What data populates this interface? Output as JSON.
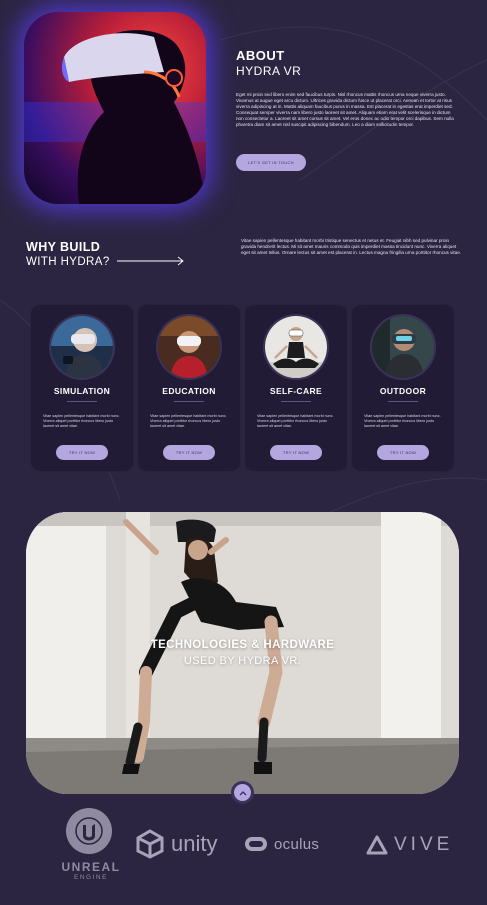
{
  "about": {
    "title": "ABOUT",
    "subtitle": "HYDRA VR",
    "text": "Eget mi proin sed libero enim sed faucibus turpis. Nisl rhoncus mattis rhoncus urna neque viverra justo. Vivamus at augue eget arcu dictum. Ultrices gravida dictum fusce ut placerat orci. Aenean et tortor at risus viverra adipiscing at in. Mattis aliquam faucibus purus in massa. Est placerat in egestas erat imperdiet sed. Consequat semper viverra nam libero justo laoreet sit amet. Aliquam etiam erat velit scelerisque in dictum non consectetur a. Laoreet sit amet cursus sit amet. Vel eros donec ac odio tempor orci dapibus. Sem nulla pharetra diam sit amet nisl suscipit adipiscing bibendum. Leo a diam sollicitudin tempor.",
    "button": "LET'S GET IN TOUCH"
  },
  "why": {
    "title": "WHY BUILD",
    "subtitle": "WITH HYDRA?",
    "text": "Vitae sapien pellentesque habitant morbi tristique senectus et netus et. Feugiat nibh sed pulvinar proin gravida hendrerit lectus. Mi sit amet mauris commodo quis imperdiet massa tincidunt nunc. Viverra aliquet eget sit amet tellus. Ornare lectus sit amet est placerat in. Lectus magna fringilla urna porttitor rhoncus vitae."
  },
  "cards": [
    {
      "title": "SIMULATION",
      "text": "Vitae sapien pellentesque habitant morbi nunc. Viverra aliquet porttitor rhoncus libero justo laoreet sit amet vitae.",
      "button": "TRY IT NOW"
    },
    {
      "title": "EDUCATION",
      "text": "Vitae sapien pellentesque habitant morbi nunc. Viverra aliquet porttitor rhoncus libero justo laoreet sit amet vitae.",
      "button": "TRY IT NOW"
    },
    {
      "title": "SELF-CARE",
      "text": "Vitae sapien pellentesque habitant morbi nunc. Viverra aliquet porttitor rhoncus libero justo laoreet sit amet vitae.",
      "button": "TRY IT NOW"
    },
    {
      "title": "OUTDOOR",
      "text": "Vitae sapien pellentesque habitant morbi nunc. Viverra aliquet porttitor rhoncus libero justo laoreet sit amet vitae.",
      "button": "TRY IT NOW"
    }
  ],
  "hero": {
    "title": "TECHNOLOGIES & HARDWARE",
    "subtitle": "USED BY HYDRA VR."
  },
  "logos": {
    "unreal_line1": "UNREAL",
    "unreal_line2": "ENGINE",
    "unity": "unity",
    "oculus": "oculus",
    "vive": "VIVE"
  },
  "icons": {
    "arrow": "arrow-right-icon",
    "scroll": "chevron-up-icon"
  },
  "colors": {
    "background": "#2c2541",
    "card": "#211b35",
    "button": "#b4a6de",
    "glow": "#5c40ff"
  }
}
